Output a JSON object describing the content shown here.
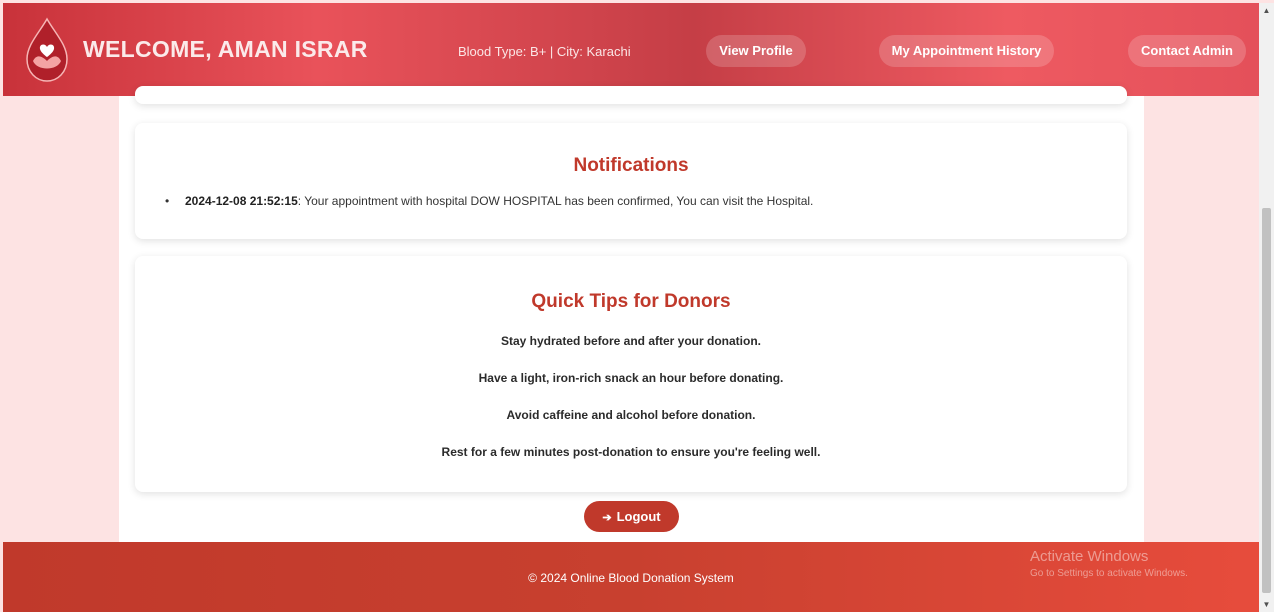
{
  "header": {
    "welcome": "WELCOME, AMAN ISRAR",
    "blood_info": "Blood Type: B+ | City: Karachi",
    "nav": {
      "view_profile": "View Profile",
      "appointment_history": "My Appointment History",
      "contact_admin": "Contact Admin"
    }
  },
  "notifications": {
    "title": "Notifications",
    "items": [
      {
        "timestamp": "2024-12-08 21:52:15",
        "message": ": Your appointment with hospital DOW HOSPITAL has been confirmed, You can visit the Hospital."
      }
    ]
  },
  "tips": {
    "title": "Quick Tips for Donors",
    "items": [
      "Stay hydrated before and after your donation.",
      "Have a light, iron-rich snack an hour before donating.",
      "Avoid caffeine and alcohol before donation.",
      "Rest for a few minutes post-donation to ensure you're feeling well."
    ]
  },
  "logout": {
    "icon": "sign-out-icon",
    "label": "Logout"
  },
  "footer": {
    "text": "© 2024 Online Blood Donation System"
  },
  "watermark": {
    "title": "Activate Windows",
    "subtitle": "Go to Settings to activate Windows."
  },
  "colors": {
    "primary": "#c0392b",
    "background": "#fde3e3"
  }
}
